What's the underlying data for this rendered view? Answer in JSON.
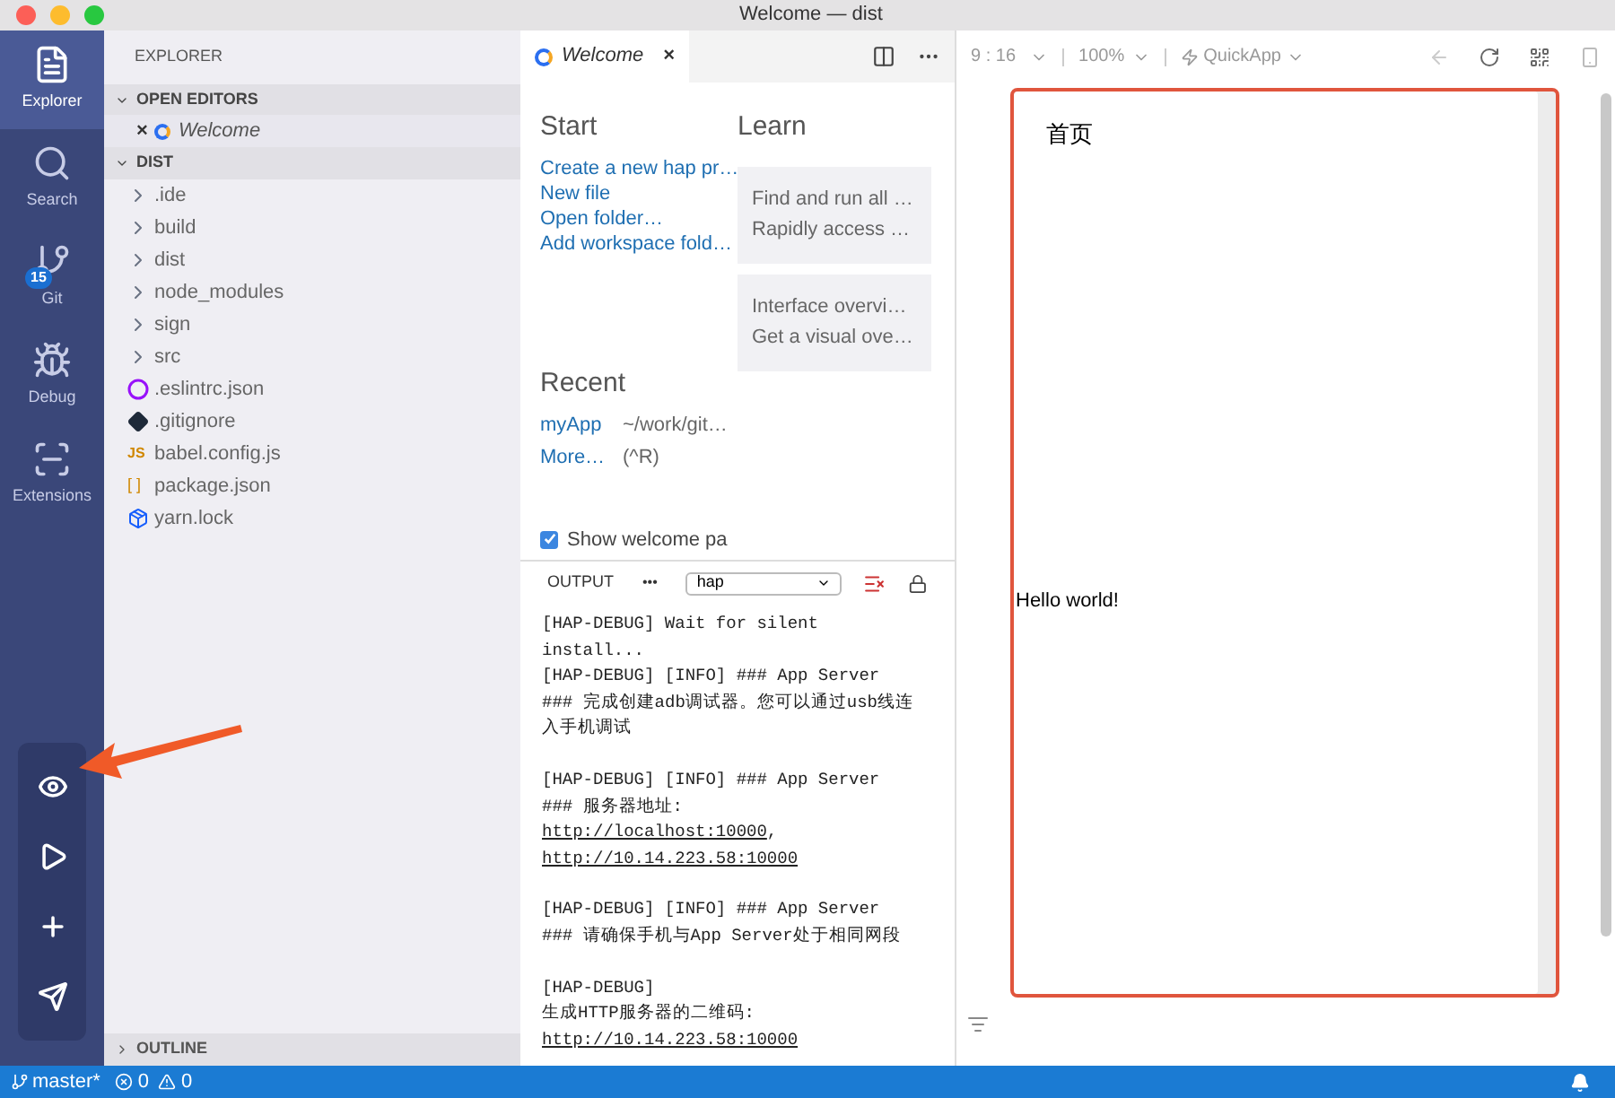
{
  "window": {
    "title": "Welcome — dist"
  },
  "activity_bar": {
    "items": [
      {
        "label": "Explorer",
        "kind": "explorer",
        "selected": true
      },
      {
        "label": "Search",
        "kind": "search",
        "selected": false
      },
      {
        "label": "Git",
        "kind": "git",
        "selected": false,
        "badge": "15"
      },
      {
        "label": "Debug",
        "kind": "debug",
        "selected": false
      },
      {
        "label": "Extensions",
        "kind": "extensions",
        "selected": false
      }
    ],
    "tools": [
      {
        "kind": "preview"
      },
      {
        "kind": "run"
      },
      {
        "kind": "add"
      },
      {
        "kind": "send"
      }
    ]
  },
  "explorer": {
    "title": "EXPLORER",
    "open_editors": {
      "title": "OPEN EDITORS",
      "expanded": true,
      "items": [
        {
          "label": "Welcome",
          "close": "×"
        }
      ]
    },
    "dist": {
      "title": "DIST",
      "expanded": true,
      "items": [
        {
          "label": ".ide",
          "kind": "folder"
        },
        {
          "label": "build",
          "kind": "folder"
        },
        {
          "label": "dist",
          "kind": "folder"
        },
        {
          "label": "node_modules",
          "kind": "folder"
        },
        {
          "label": "sign",
          "kind": "folder"
        },
        {
          "label": "src",
          "kind": "folder"
        },
        {
          "label": ".eslintrc.json",
          "kind": "eslint"
        },
        {
          "label": ".gitignore",
          "kind": "git"
        },
        {
          "label": "babel.config.js",
          "kind": "js",
          "icon_text": "JS"
        },
        {
          "label": "package.json",
          "kind": "json",
          "icon_text": "[ ]"
        },
        {
          "label": "yarn.lock",
          "kind": "yarn"
        }
      ]
    },
    "outline": {
      "title": "OUTLINE",
      "expanded": false
    }
  },
  "editor": {
    "tab": {
      "label": "Welcome",
      "close": "×"
    },
    "start": {
      "title": "Start",
      "links": [
        "Create a new hap pr…",
        "New file",
        "Open folder…",
        "Add workspace fold…"
      ]
    },
    "learn": {
      "title": "Learn",
      "cards": [
        {
          "title": "Find and run all …",
          "description": "Rapidly access …"
        },
        {
          "title": "Interface overvi…",
          "description": "Get a visual ove…"
        }
      ]
    },
    "recent": {
      "title": "Recent",
      "items": [
        {
          "name": "myApp",
          "detail": "~/work/git…"
        },
        {
          "name": "More…",
          "detail": "(^R)"
        }
      ]
    },
    "show_welcome": {
      "label": "Show welcome pa",
      "checked": true
    }
  },
  "output": {
    "title": "OUTPUT",
    "more": "•••",
    "channel": "hap",
    "messages": [
      [
        {
          "kind": "text",
          "text": "[HAP-DEBUG] Wait for silent"
        },
        {
          "kind": "text",
          "text": "install..."
        },
        {
          "kind": "text",
          "text": "[HAP-DEBUG] [INFO] ### App Server"
        },
        {
          "kind": "text",
          "text": "### 完成创建adb调试器。您可以通过usb线连"
        },
        {
          "kind": "text",
          "text": "入手机调试"
        }
      ],
      [
        {
          "kind": "text",
          "text": "[HAP-DEBUG] [INFO] ### App Server"
        },
        {
          "kind": "text",
          "text": "### 服务器地址:"
        },
        {
          "kind": "link",
          "text": "http://localhost:10000",
          "suffix": ","
        },
        {
          "kind": "link",
          "text": "http://10.14.223.58:10000"
        }
      ],
      [
        {
          "kind": "text",
          "text": "[HAP-DEBUG] [INFO] ### App Server"
        },
        {
          "kind": "text",
          "text": "### 请确保手机与App Server处于相同网段"
        }
      ],
      [
        {
          "kind": "text",
          "text": "[HAP-DEBUG]"
        },
        {
          "kind": "text",
          "text": "生成HTTP服务器的二维码:"
        },
        {
          "kind": "link",
          "text": "http://10.14.223.58:10000"
        }
      ]
    ]
  },
  "preview": {
    "ratio": "9 : 16",
    "zoom": "100%",
    "platform": "QuickApp",
    "page_title": "首页",
    "body_text": "Hello world!"
  },
  "status_bar": {
    "branch": "master*",
    "errors": "0",
    "warnings": "0"
  }
}
